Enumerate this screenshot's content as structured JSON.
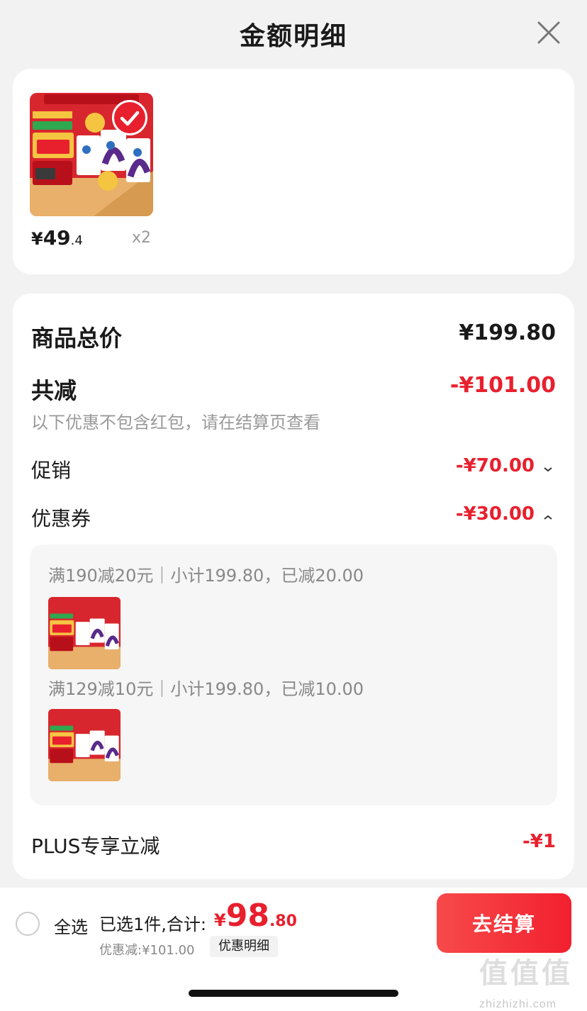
{
  "header": {
    "title": "金额明细",
    "close_icon": "close-icon"
  },
  "product": {
    "image_icon": "yili-milk-product-image",
    "selected_icon": "checkmark-icon",
    "price_yen": "¥",
    "price_int": "49",
    "price_dec": ".4",
    "quantity": "x2"
  },
  "summary": {
    "total_label": "商品总价",
    "total_value": "¥199.80",
    "reduce_label": "共减",
    "reduce_value": "-¥101.00",
    "reduce_note": "以下优惠不包含红包，请在结算页查看",
    "promo_label": "促销",
    "promo_value": "-¥70.00",
    "promo_chevron": "chevron-down-icon",
    "coupon_label": "优惠券",
    "coupon_value": "-¥30.00",
    "coupon_chevron": "chevron-up-icon",
    "coupon_rules": [
      "满190减20元｜小计199.80，已减20.00",
      "满129减10元｜小计199.80，已减10.00"
    ],
    "plus_label": "PLUS专享立减",
    "plus_value": "-¥1"
  },
  "bottom": {
    "select_all": "全选",
    "selected_text": "已选1件,合计:",
    "total_yen": "¥",
    "total_int": "98",
    "total_dec": ".80",
    "discount_text": "优惠减:¥101.00",
    "detail_label": "优惠明细",
    "checkout_label": "去结算"
  },
  "watermark": {
    "glyphs": "值值值",
    "text": "zhizhizhi.com"
  },
  "colors": {
    "accent": "#e8202e",
    "background": "#f2f2f2",
    "card": "#ffffff"
  }
}
